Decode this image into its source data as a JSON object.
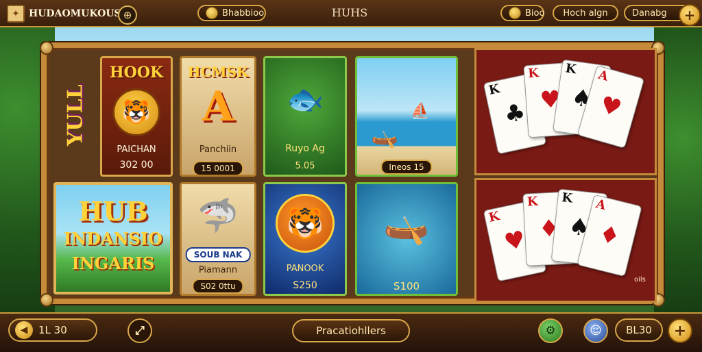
{
  "header": {
    "brand_name": "HUDAOMUKOUS",
    "mid_pill_label": "Bhabbioo",
    "title": "HUHS",
    "coins_label": "Bioo",
    "hook_label": "Hoch algn",
    "danger_label": "Danabg",
    "plus_symbol": "+"
  },
  "side_banner": "YULL",
  "tiles": [
    {
      "title": "HOOK",
      "caption": "PAICHAN",
      "value": "302 00"
    },
    {
      "title": "HCMSK",
      "big_letter": "A",
      "caption": "Panchiin",
      "value": "15 0001"
    },
    {
      "caption": "Ruyo Ag",
      "value": "5.05"
    },
    {
      "value": "Ineos 15"
    },
    {
      "title_lines": [
        "HUB",
        "INDANSIO",
        "INGARIS"
      ]
    },
    {
      "badge": "SOUB NAK",
      "caption": "Piamann",
      "value": "S02 0ttu"
    },
    {
      "caption": "PANOOK",
      "value": "S250"
    },
    {
      "value": "S100"
    }
  ],
  "cards_top": [
    {
      "rank": "K",
      "suit": "♣",
      "color": "black"
    },
    {
      "rank": "K",
      "suit": "♥",
      "color": "red"
    },
    {
      "rank": "K",
      "suit": "♠",
      "color": "black"
    },
    {
      "rank": "A",
      "suit": "♥",
      "color": "red"
    }
  ],
  "cards_bottom": [
    {
      "rank": "K",
      "suit": "♥",
      "color": "red"
    },
    {
      "rank": "K",
      "suit": "♦",
      "color": "red"
    },
    {
      "rank": "K",
      "suit": "♠",
      "color": "black"
    },
    {
      "rank": "A",
      "suit": "♦",
      "color": "red"
    }
  ],
  "corner_tag": "oils",
  "footer": {
    "bet_label": "1L 30",
    "center_label": "Pracatiohllers",
    "balance_label": "BL30",
    "plus_symbol": "+"
  },
  "colors": {
    "accent": "#d9a84a",
    "card_red": "#c8141a",
    "panel_red": "#7a1a14"
  }
}
